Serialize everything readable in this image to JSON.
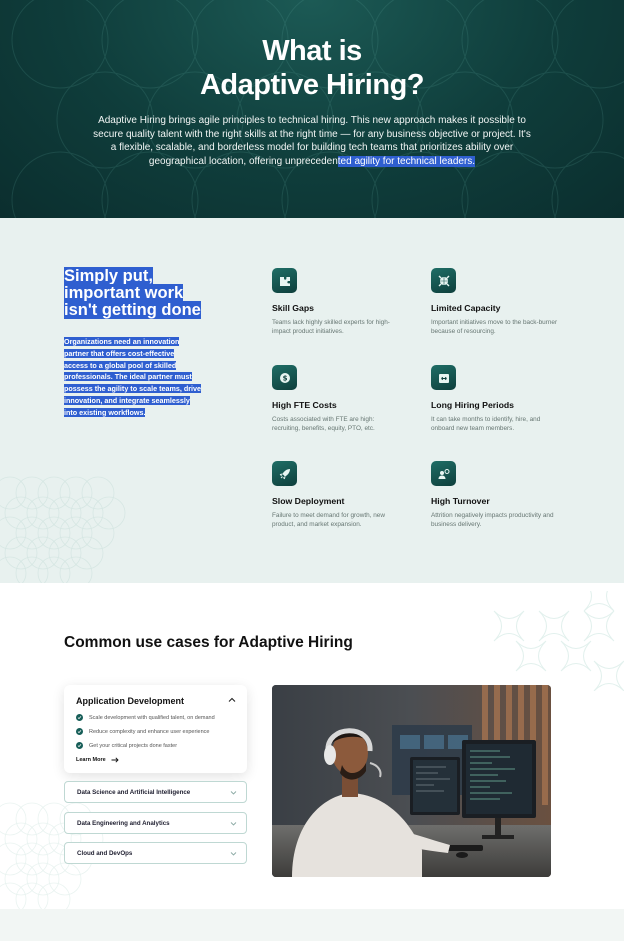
{
  "hero": {
    "title_line1": "What is",
    "title_line2": "Adaptive Hiring?",
    "body_plain": "Adaptive Hiring brings agile principles to technical hiring. This new approach makes it possible to secure quality talent with the right skills at the right time — for any business objective or project. It's a flexible, scalable, and borderless model for building tech teams that prioritizes ability over geographical location, offering unpreceden",
    "body_highlight": "ted agility for technical leaders."
  },
  "intro": {
    "title_line1": "Simply put,",
    "title_line2": "important work",
    "title_line3": "isn't getting done",
    "body_lines": [
      "Organizations need an innovation",
      "partner that offers cost-effective",
      "access to a global pool of skilled",
      "professionals. The ideal partner must",
      "possess the agility to scale teams, drive",
      "innovation, and integrate seamlessly",
      "into existing workflows."
    ]
  },
  "features": [
    {
      "title": "Skill Gaps",
      "desc": "Teams lack highly skilled experts for high-impact product initiatives.",
      "icon": "puzzle-icon"
    },
    {
      "title": "Limited Capacity",
      "desc": "Important initiatives move to the back-burner because of resourcing.",
      "icon": "compress-arrows-icon"
    },
    {
      "title": "High FTE Costs",
      "desc": "Costs associated with FTE are high: recruiting, benefits, equity, PTO, etc.",
      "icon": "money-icon"
    },
    {
      "title": "Long Hiring Periods",
      "desc": "It can take months to identify, hire, and onboard new team members.",
      "icon": "calendar-range-icon"
    },
    {
      "title": "Slow Deployment",
      "desc": "Failure to meet demand for growth, new product, and market expansion.",
      "icon": "rocket-icon"
    },
    {
      "title": "High Turnover",
      "desc": "Attrition negatively impacts productivity and business delivery.",
      "icon": "person-search-icon"
    }
  ],
  "use_cases": {
    "title": "Common use cases for Adaptive Hiring",
    "open_item": {
      "title": "Application Development",
      "points": [
        "Scale development with qualified talent, on demand",
        "Reduce complexity and enhance user experience",
        "Get your critical projects done faster"
      ],
      "link": "Learn More"
    },
    "collapsed_items": [
      "Data Science and Artificial Intelligence",
      "Data Engineering and Analytics",
      "Cloud and DevOps"
    ]
  },
  "colors": {
    "hero_dark": "#0f3d3b",
    "accent_teal": "#175e58",
    "highlight_blue": "#2f5fd0",
    "feature_bg": "#e8f1ef"
  }
}
